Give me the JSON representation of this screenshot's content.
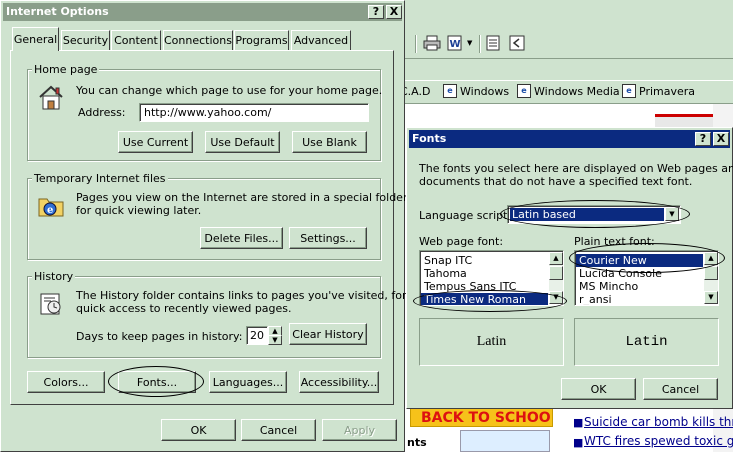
{
  "background": {
    "links_bar": [
      "C.A.D",
      "Windows",
      "Windows Media",
      "Primavera"
    ],
    "banner_text": "BACK TO SCHOOL",
    "banner_sub": "nts",
    "news": [
      "Suicide car bomb kills thr",
      "WTC fires spewed toxic g"
    ]
  },
  "internet_options": {
    "title": "Internet Options",
    "help_btn": "?",
    "close_btn": "X",
    "tabs": [
      "General",
      "Security",
      "Content",
      "Connections",
      "Programs",
      "Advanced"
    ],
    "home_page": {
      "label": "Home page",
      "description": "You can change which page to use for your home page.",
      "address_label": "Address:",
      "address_value": "http://www.yahoo.com/",
      "use_current": "Use Current",
      "use_default": "Use Default",
      "use_blank": "Use Blank"
    },
    "temp_files": {
      "label": "Temporary Internet files",
      "line1": "Pages you view on the Internet are stored in a special folder",
      "line2": "for quick viewing later.",
      "delete_files": "Delete Files...",
      "settings": "Settings..."
    },
    "history": {
      "label": "History",
      "line1": "The History folder contains links to pages you've visited, for",
      "line2": "quick access to recently viewed pages.",
      "days_label": "Days to keep pages in history:",
      "days_value": "20",
      "clear_history": "Clear History"
    },
    "bottom_buttons": {
      "colors": "Colors...",
      "fonts": "Fonts...",
      "languages": "Languages...",
      "accessibility": "Accessibility..."
    },
    "ok": "OK",
    "cancel": "Cancel",
    "apply": "Apply"
  },
  "fonts_dialog": {
    "title": "Fonts",
    "help_btn": "?",
    "close_btn": "X",
    "desc_line1": "The fonts you select here are displayed on Web pages and",
    "desc_line2": "documents that do not have a specified text font.",
    "language_label": "Language script:",
    "language_value": "Latin based",
    "web_font_label": "Web page font:",
    "web_fonts": [
      "Snap ITC",
      "Tahoma",
      "Tempus Sans ITC",
      "Times New Roman"
    ],
    "plain_font_label": "Plain text font:",
    "plain_fonts": [
      "Courier New",
      "Lucida Console",
      "MS Mincho",
      "r_ansi"
    ],
    "web_preview": "Latin",
    "plain_preview": "Latin",
    "ok": "OK",
    "cancel": "Cancel"
  },
  "colors": {
    "window_face": "#cfe3cf",
    "titlebar_inactive": "#8a9e8a",
    "titlebar_active": "#0b2a80",
    "selection": "#0b2a80",
    "link": "#00008b"
  }
}
